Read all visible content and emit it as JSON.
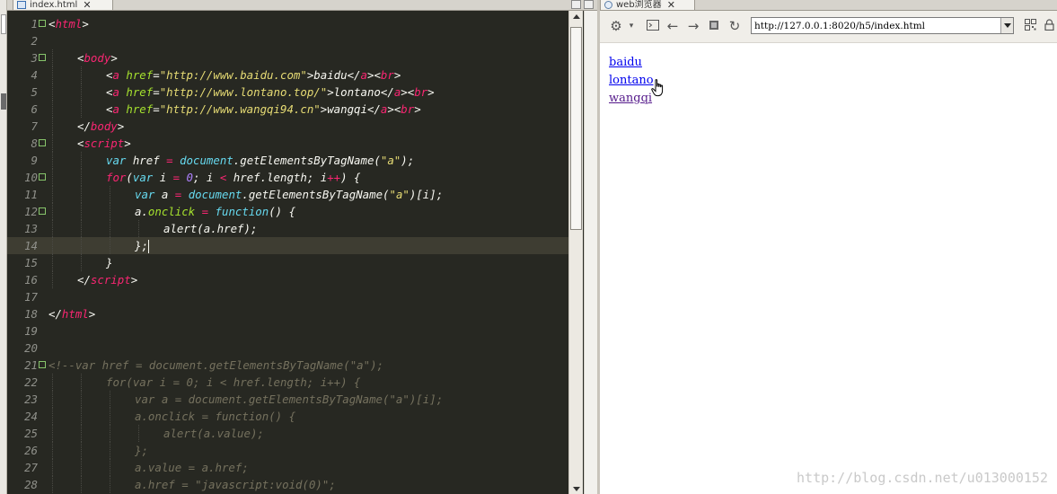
{
  "editor": {
    "tab_title": "index.html",
    "tab_close": "✕",
    "lines": [
      {
        "n": "1",
        "fold": true,
        "indent": 0,
        "tokens": [
          [
            "p",
            "<"
          ],
          [
            "tag",
            "html"
          ],
          [
            "p",
            ">"
          ]
        ]
      },
      {
        "n": "2",
        "fold": false,
        "indent": 0,
        "tokens": []
      },
      {
        "n": "3",
        "fold": true,
        "indent": 1,
        "tokens": [
          [
            "p",
            "<"
          ],
          [
            "tag",
            "body"
          ],
          [
            "p",
            ">"
          ]
        ]
      },
      {
        "n": "4",
        "fold": false,
        "indent": 2,
        "tokens": [
          [
            "p",
            "<"
          ],
          [
            "tag",
            "a "
          ],
          [
            "attr",
            "href"
          ],
          [
            "p",
            "="
          ],
          [
            "str",
            "\"http://www.baidu.com\""
          ],
          [
            "p",
            ">baidu</"
          ],
          [
            "tag",
            "a"
          ],
          [
            "p",
            "><"
          ],
          [
            "tag",
            "br"
          ],
          [
            "p",
            ">"
          ]
        ]
      },
      {
        "n": "5",
        "fold": false,
        "indent": 2,
        "tokens": [
          [
            "p",
            "<"
          ],
          [
            "tag",
            "a "
          ],
          [
            "attr",
            "href"
          ],
          [
            "p",
            "="
          ],
          [
            "str",
            "\"http://www.lontano.top/\""
          ],
          [
            "p",
            ">lontano</"
          ],
          [
            "tag",
            "a"
          ],
          [
            "p",
            "><"
          ],
          [
            "tag",
            "br"
          ],
          [
            "p",
            ">"
          ]
        ]
      },
      {
        "n": "6",
        "fold": false,
        "indent": 2,
        "tokens": [
          [
            "p",
            "<"
          ],
          [
            "tag",
            "a "
          ],
          [
            "attr",
            "href"
          ],
          [
            "p",
            "="
          ],
          [
            "str",
            "\"http://www.wangqi94.cn\""
          ],
          [
            "p",
            ">wangqi</"
          ],
          [
            "tag",
            "a"
          ],
          [
            "p",
            "><"
          ],
          [
            "tag",
            "br"
          ],
          [
            "p",
            ">"
          ]
        ]
      },
      {
        "n": "7",
        "fold": false,
        "indent": 1,
        "tokens": [
          [
            "p",
            "</"
          ],
          [
            "tag",
            "body"
          ],
          [
            "p",
            ">"
          ]
        ]
      },
      {
        "n": "8",
        "fold": true,
        "indent": 1,
        "tokens": [
          [
            "p",
            "<"
          ],
          [
            "tag",
            "script"
          ],
          [
            "p",
            ">"
          ]
        ]
      },
      {
        "n": "9",
        "fold": false,
        "indent": 2,
        "tokens": [
          [
            "kw",
            "var "
          ],
          [
            "p",
            "href "
          ],
          [
            "op",
            "= "
          ],
          [
            "kw",
            "document"
          ],
          [
            "p",
            "."
          ],
          [
            "p",
            "getElementsByTagName("
          ],
          [
            "str",
            "\"a\""
          ],
          [
            "p",
            ");"
          ]
        ]
      },
      {
        "n": "10",
        "fold": true,
        "indent": 2,
        "tokens": [
          [
            "op",
            "for"
          ],
          [
            "p",
            "("
          ],
          [
            "kw",
            "var "
          ],
          [
            "p",
            "i "
          ],
          [
            "op",
            "= "
          ],
          [
            "num",
            "0"
          ],
          [
            "p",
            "; i "
          ],
          [
            "op",
            "< "
          ],
          [
            "p",
            "href.length; i"
          ],
          [
            "op",
            "++"
          ],
          [
            "p",
            ") {"
          ]
        ]
      },
      {
        "n": "11",
        "fold": false,
        "indent": 3,
        "tokens": [
          [
            "kw",
            "var "
          ],
          [
            "p",
            "a "
          ],
          [
            "op",
            "= "
          ],
          [
            "kw",
            "document"
          ],
          [
            "p",
            ".getElementsByTagName("
          ],
          [
            "str",
            "\"a\""
          ],
          [
            "p",
            ")[i];"
          ]
        ]
      },
      {
        "n": "12",
        "fold": true,
        "indent": 3,
        "tokens": [
          [
            "p",
            "a."
          ],
          [
            "attr",
            "onclick "
          ],
          [
            "op",
            "= "
          ],
          [
            "kw",
            "function"
          ],
          [
            "p",
            "() {"
          ]
        ]
      },
      {
        "n": "13",
        "fold": false,
        "indent": 4,
        "tokens": [
          [
            "p",
            "alert(a.href);"
          ]
        ]
      },
      {
        "n": "14",
        "fold": false,
        "indent": 3,
        "current": true,
        "tokens": [
          [
            "p",
            "};"
          ]
        ]
      },
      {
        "n": "15",
        "fold": false,
        "indent": 2,
        "tokens": [
          [
            "p",
            "}"
          ]
        ]
      },
      {
        "n": "16",
        "fold": false,
        "indent": 1,
        "tokens": [
          [
            "p",
            "</"
          ],
          [
            "tag",
            "script"
          ],
          [
            "p",
            ">"
          ]
        ]
      },
      {
        "n": "17",
        "fold": false,
        "indent": 0,
        "tokens": []
      },
      {
        "n": "18",
        "fold": false,
        "indent": 0,
        "tokens": [
          [
            "p",
            "</"
          ],
          [
            "tag",
            "html"
          ],
          [
            "p",
            ">"
          ]
        ]
      },
      {
        "n": "19",
        "fold": false,
        "indent": 0,
        "tokens": []
      },
      {
        "n": "20",
        "fold": false,
        "indent": 0,
        "tokens": []
      },
      {
        "n": "21",
        "fold": true,
        "indent": 0,
        "tokens": [
          [
            "cm",
            "<!--var href = document.getElementsByTagName(\"a\");"
          ]
        ]
      },
      {
        "n": "22",
        "fold": false,
        "indent": 2,
        "tokens": [
          [
            "cm",
            "for(var i = 0; i < href.length; i++) {"
          ]
        ]
      },
      {
        "n": "23",
        "fold": false,
        "indent": 3,
        "tokens": [
          [
            "cm",
            "var a = document.getElementsByTagName(\"a\")[i];"
          ]
        ]
      },
      {
        "n": "24",
        "fold": false,
        "indent": 3,
        "tokens": [
          [
            "cm",
            "a.onclick = function() {"
          ]
        ]
      },
      {
        "n": "25",
        "fold": false,
        "indent": 4,
        "tokens": [
          [
            "cm",
            "alert(a.value);"
          ]
        ]
      },
      {
        "n": "26",
        "fold": false,
        "indent": 3,
        "tokens": [
          [
            "cm",
            "};"
          ]
        ]
      },
      {
        "n": "27",
        "fold": false,
        "indent": 3,
        "tokens": [
          [
            "cm",
            "a.value = a.href;"
          ]
        ]
      },
      {
        "n": "28",
        "fold": false,
        "indent": 3,
        "tokens": [
          [
            "cm",
            "a.href = \"javascript:void(0)\";"
          ]
        ]
      }
    ]
  },
  "browser": {
    "tab_title": "web浏览器",
    "tab_close": "✕",
    "url": "http://127.0.0.1:8020/h5/index.html",
    "links": [
      {
        "label": "baidu",
        "visited": false
      },
      {
        "label": "lontano",
        "visited": false
      },
      {
        "label": "wangqi",
        "visited": true
      }
    ]
  },
  "watermark": "http://blog.csdn.net/u013000152",
  "colors": {
    "editor_bg": "#272822",
    "tag": "#f92672",
    "attr": "#a6e22e",
    "string": "#e6db74",
    "keyword": "#66d9ef",
    "number": "#ae81ff",
    "comment": "#75715e",
    "link": "#0000ee",
    "visited_link": "#551a8b"
  },
  "icons": [
    "gear-icon",
    "console-icon",
    "back-arrow-icon",
    "forward-arrow-icon",
    "stop-icon",
    "refresh-icon",
    "qrcode-icon",
    "lock-icon",
    "globe-icon",
    "file-icon",
    "hand-cursor-icon"
  ]
}
